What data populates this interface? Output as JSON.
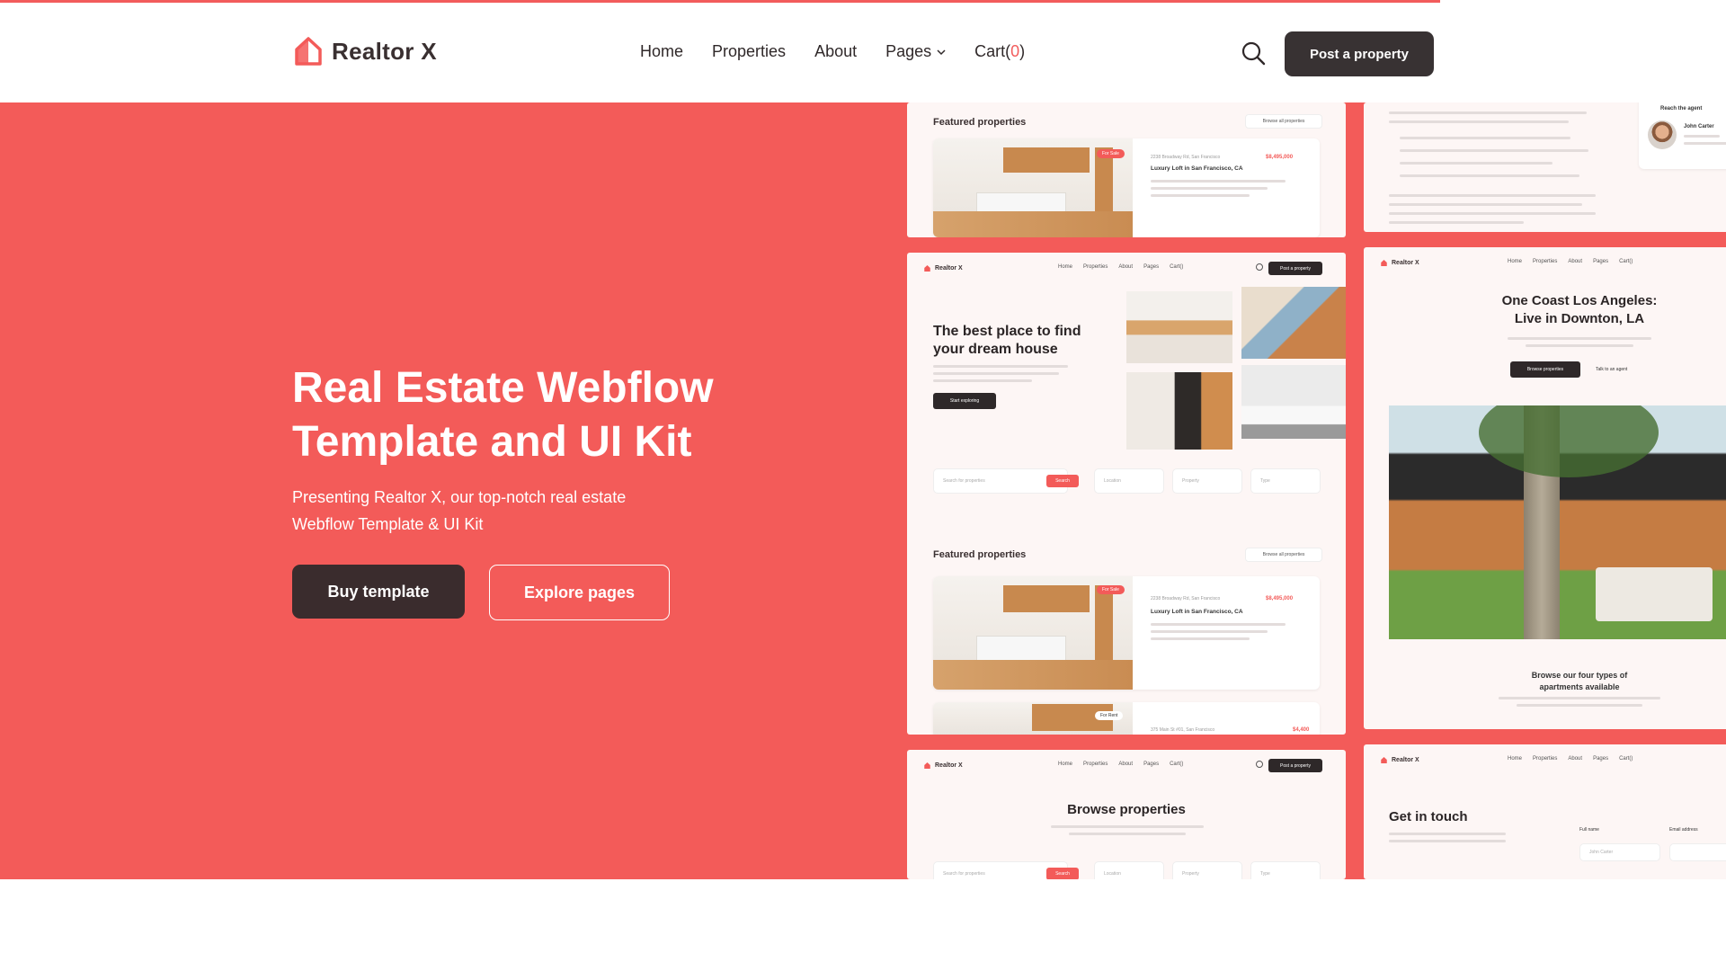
{
  "brand": {
    "name": "Realtor X",
    "accent": "#f35b59",
    "dark": "#383233"
  },
  "nav": {
    "items": [
      {
        "label": "Home"
      },
      {
        "label": "Properties"
      },
      {
        "label": "About"
      },
      {
        "label": "Pages"
      },
      {
        "label": "Cart(",
        "count": "0",
        "close": ")"
      }
    ],
    "cta": "Post a property",
    "search_icon": "search-icon"
  },
  "hero": {
    "title": "Real Estate Webflow Template and UI Kit",
    "subtitle": "Presenting Realtor X, our top-notch real estate Webflow Template & UI Kit",
    "primary_button": "Buy template",
    "secondary_button": "Explore pages"
  },
  "previews": {
    "featured": {
      "title": "Featured properties",
      "browse": "Browse all properties",
      "tag_sale": "For Sale",
      "tag_rent": "For Rent",
      "address": "2238 Broadway Rd, San Francisco",
      "listing_title": "Luxury Loft in San Francisco, CA",
      "price": "$8,495,000",
      "address2": "375 Main St #01, San Francisco",
      "price2": "$4,400"
    },
    "home": {
      "logo": "Realtor X",
      "menu": [
        "Home",
        "Properties",
        "About",
        "Pages",
        "Cart()"
      ],
      "post": "Post a property",
      "headline": "The best place to find your dream house",
      "cta": "Start exploring",
      "search_placeholder": "Search for properties",
      "search_btn": "Search",
      "location": "Location",
      "property": "Property",
      "type": "Type"
    },
    "property": {
      "headline": "One Coast Los Angeles: Live in Downton, LA",
      "primary": "Browse properties",
      "secondary": "Talk to an agent",
      "browse_types": "Browse our four types of apartments available"
    },
    "agent": {
      "label": "Reach the agent",
      "name": "John Carter"
    },
    "browse": {
      "title": "Browse properties"
    },
    "contact": {
      "title": "Get in touch",
      "full_name": "Full name",
      "email": "Email address",
      "name_placeholder": "John Carter"
    }
  }
}
